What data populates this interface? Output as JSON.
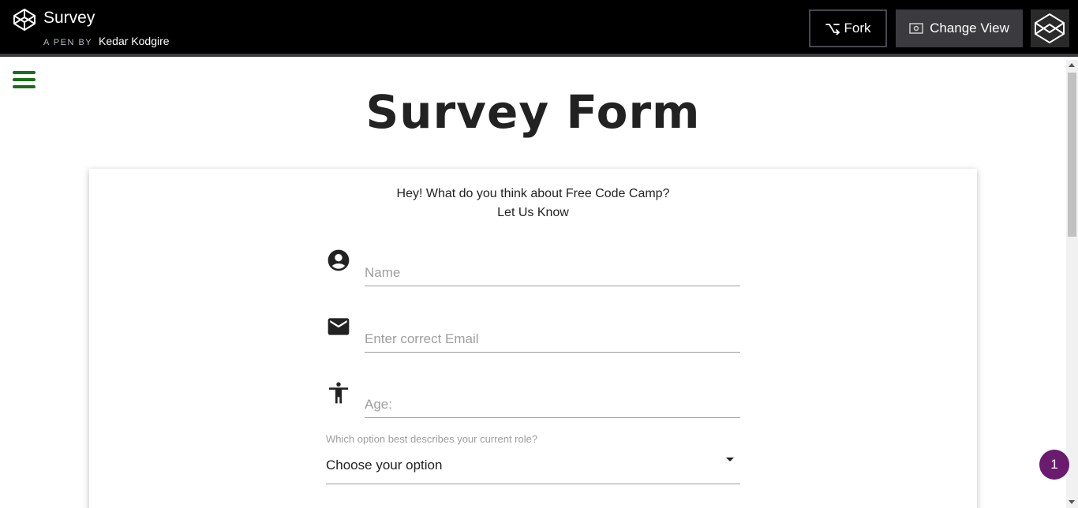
{
  "header": {
    "pen_title": "Survey",
    "by_label": "A PEN BY",
    "author": "Kedar Kodgire",
    "fork_label": "Fork",
    "change_view_label": "Change View"
  },
  "page": {
    "title": "Survey Form",
    "intro_line1": "Hey! What do you think about Free Code Camp?",
    "intro_line2": "Let Us Know"
  },
  "form": {
    "name_placeholder": "Name",
    "email_placeholder": "Enter correct Email",
    "age_placeholder": "Age:",
    "role_label": "Which option best describes your current role?",
    "role_value": "Choose your option"
  },
  "notification_count": "1",
  "colors": {
    "accent_green": "#1b6e1b",
    "badge_purple": "#6a1b6e",
    "header_bg": "#000000"
  }
}
